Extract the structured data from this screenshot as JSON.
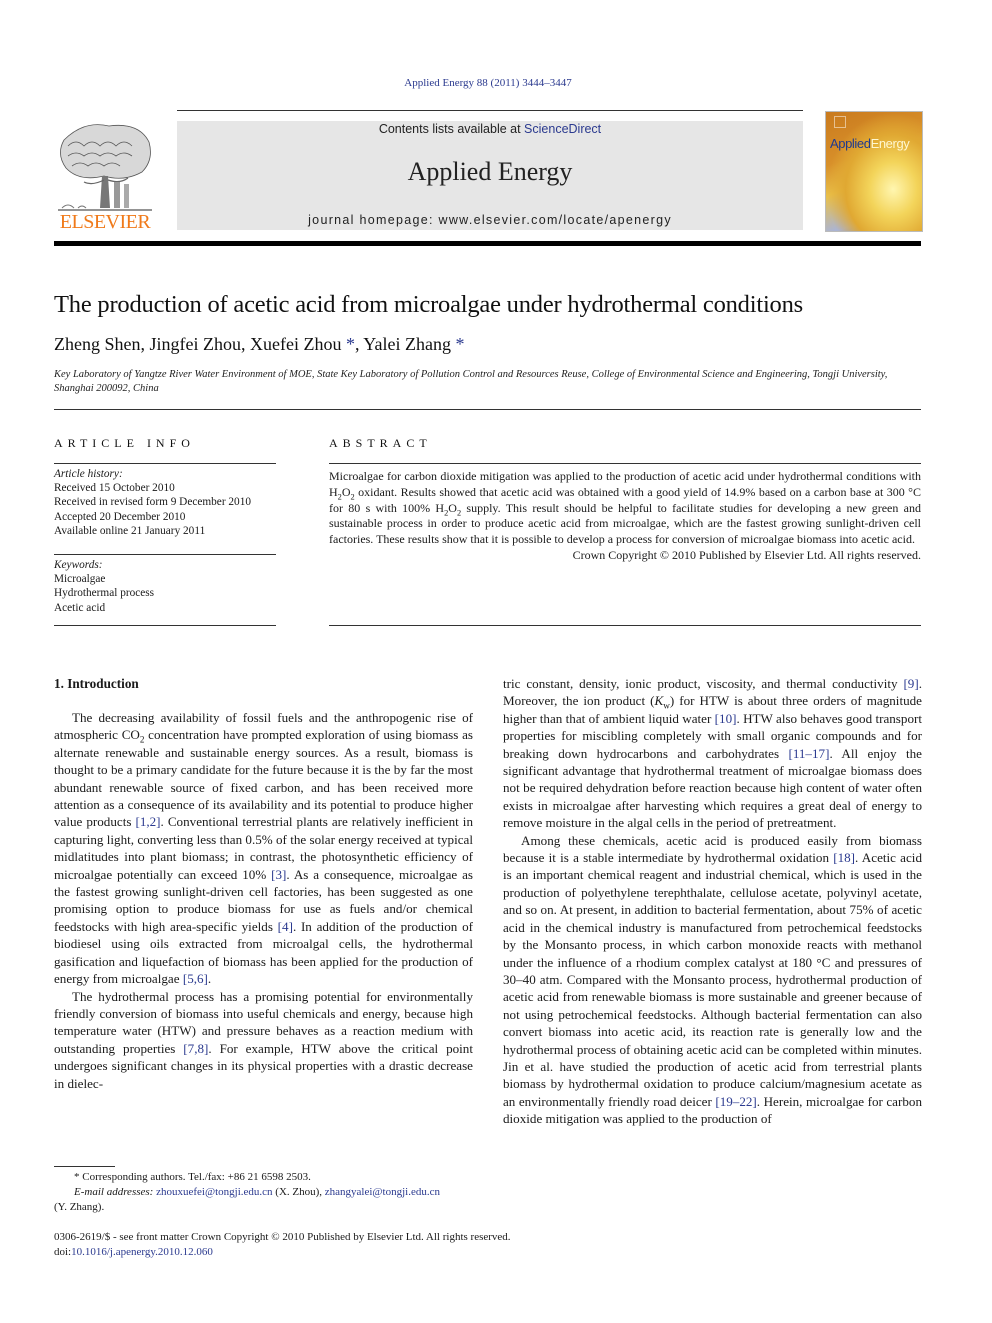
{
  "header": {
    "citation": "Applied Energy 88 (2011) 3444–3447",
    "contents_prefix": "Contents lists available at ",
    "contents_link": "ScienceDirect",
    "journal_name": "Applied Energy",
    "homepage": "journal homepage: www.elsevier.com/locate/apenergy",
    "publisher_logo_text": "ELSEVIER",
    "cover": {
      "title_part1": "Applied",
      "title_part2": "Energy"
    },
    "colors": {
      "publisher_orange": "#f07a1a",
      "link_blue": "#2b3a8f",
      "masthead_gray": "#e6e6e6"
    }
  },
  "article": {
    "title": "The production of acetic acid from microalgae under hydrothermal conditions",
    "authors": [
      {
        "name": "Zheng Shen",
        "corresponding": false
      },
      {
        "name": "Jingfei Zhou",
        "corresponding": false
      },
      {
        "name": "Xuefei Zhou",
        "corresponding": true
      },
      {
        "name": "Yalei Zhang",
        "corresponding": true
      }
    ],
    "affiliation": "Key Laboratory of Yangtze River Water Environment of MOE, State Key Laboratory of Pollution Control and Resources Reuse, College of Environmental Science and Engineering, Tongji University, Shanghai 200092, China"
  },
  "article_info": {
    "heading": "ARTICLE INFO",
    "history_label": "Article history:",
    "history": [
      "Received 15 October 2010",
      "Received in revised form 9 December 2010",
      "Accepted 20 December 2010",
      "Available online 21 January 2011"
    ],
    "keywords_label": "Keywords:",
    "keywords": [
      "Microalgae",
      "Hydrothermal process",
      "Acetic acid"
    ]
  },
  "abstract": {
    "heading": "ABSTRACT",
    "text": "Microalgae for carbon dioxide mitigation was applied to the production of acetic acid under hydrothermal conditions with H2O2 oxidant. Results showed that acetic acid was obtained with a good yield of 14.9% based on a carbon base at 300 °C for 80 s with 100% H2O2 supply. This result should be helpful to facilitate studies for developing a new green and sustainable process in order to produce acetic acid from microalgae, which are the fastest growing sunlight-driven cell factories. These results show that it is possible to develop a process for conversion of microalgae biomass into acetic acid.",
    "copyright": "Crown Copyright © 2010 Published by Elsevier Ltd. All rights reserved."
  },
  "introduction": {
    "heading": "1. Introduction",
    "paragraphs": [
      [
        {
          "t": "The decreasing availability of fossil fuels and the anthropogenic rise of atmospheric CO"
        },
        {
          "sub": "2"
        },
        {
          "t": " concentration have prompted exploration of using biomass as alternate renewable and sustainable energy sources. As a result, biomass is thought to be a primary candidate for the future because it is the by far the most abundant renewable source of fixed carbon, and has been received more attention as a consequence of its availability and its potential to produce higher value products "
        },
        {
          "ref": "[1,2]"
        },
        {
          "t": ". Conventional terrestrial plants are relatively inefficient in capturing light, converting less than 0.5% of the solar energy received at typical midlatitudes into plant biomass; in contrast, the photosynthetic efficiency of microalgae potentially can exceed 10% "
        },
        {
          "ref": "[3]"
        },
        {
          "t": ". As a consequence, microalgae as the fastest growing sunlight-driven cell factories, has been suggested as one promising option to produce biomass for use as fuels and/or chemical feedstocks with high area-specific yields "
        },
        {
          "ref": "[4]"
        },
        {
          "t": ". In addition of the production of biodiesel using oils extracted from microalgal cells, the hydrothermal gasification and liquefaction of biomass has been applied for the production of energy from microalgae "
        },
        {
          "ref": "[5,6]"
        },
        {
          "t": "."
        }
      ],
      [
        {
          "t": "The hydrothermal process has a promising potential for environmentally friendly conversion of biomass into useful chemicals and energy, because high temperature water (HTW) and pressure behaves as a reaction medium with outstanding properties "
        },
        {
          "ref": "[7,8]"
        },
        {
          "t": ". For example, HTW above the critical point undergoes significant changes in its physical properties with a drastic decrease in dielec-"
        }
      ]
    ],
    "right_paragraphs": [
      [
        {
          "t": "tric constant, density, ionic product, viscosity, and thermal conductivity "
        },
        {
          "ref": "[9]"
        },
        {
          "t": ". Moreover, the ion product ("
        },
        {
          "i": "K"
        },
        {
          "sub": "w"
        },
        {
          "t": ") for HTW is about three orders of magnitude higher than that of ambient liquid water "
        },
        {
          "ref": "[10]"
        },
        {
          "t": ". HTW also behaves good transport properties for miscibling completely with small organic compounds and for breaking down hydrocarbons and carbohydrates "
        },
        {
          "ref": "[11–17]"
        },
        {
          "t": ". All enjoy the significant advantage that hydrothermal treatment of microalgae biomass does not be required dehydration before reaction because high content of water often exists in microalgae after harvesting which requires a great deal of energy to remove moisture in the algal cells in the period of pretreatment."
        }
      ],
      [
        {
          "t": "Among these chemicals, acetic acid is produced easily from biomass because it is a stable intermediate by hydrothermal oxidation "
        },
        {
          "ref": "[18]"
        },
        {
          "t": ". Acetic acid is an important chemical reagent and industrial chemical, which is used in the production of polyethylene terephthalate, cellulose acetate, polyvinyl acetate, and so on. At present, in addition to bacterial fermentation, about 75% of acetic acid in the chemical industry is manufactured from petrochemical feedstocks by the Monsanto process, in which carbon monoxide reacts with methanol under the influence of a rhodium complex catalyst at 180 °C and pressures of 30–40 atm. Compared with the Monsanto process, hydrothermal production of acetic acid from renewable biomass is more sustainable and greener because of not using petrochemical feedstocks. Although bacterial fermentation can also convert biomass into acetic acid, its reaction rate is generally low and the hydrothermal process of obtaining acetic acid can be completed within minutes. Jin et al. have studied the production of acetic acid from terrestrial plants biomass by hydrothermal oxidation to produce calcium/magnesium acetate as an environmentally friendly road deicer "
        },
        {
          "ref": "[19–22]"
        },
        {
          "t": ". Herein, microalgae for carbon dioxide mitigation was applied to the production of"
        }
      ]
    ]
  },
  "footnotes": {
    "corresponding": "Corresponding authors. Tel./fax: +86 21 6598 2503.",
    "email_label": "E-mail addresses:",
    "emails": [
      {
        "address": "zhouxuefei@tongji.edu.cn",
        "who": "(X. Zhou)"
      },
      {
        "address": "zhangyalei@tongji.edu.cn",
        "who": "(Y. Zhang)."
      }
    ]
  },
  "bottom": {
    "issn_line": "0306-2619/$ - see front matter Crown Copyright © 2010 Published by Elsevier Ltd. All rights reserved.",
    "doi_prefix": "doi:",
    "doi": "10.1016/j.apenergy.2010.12.060"
  }
}
